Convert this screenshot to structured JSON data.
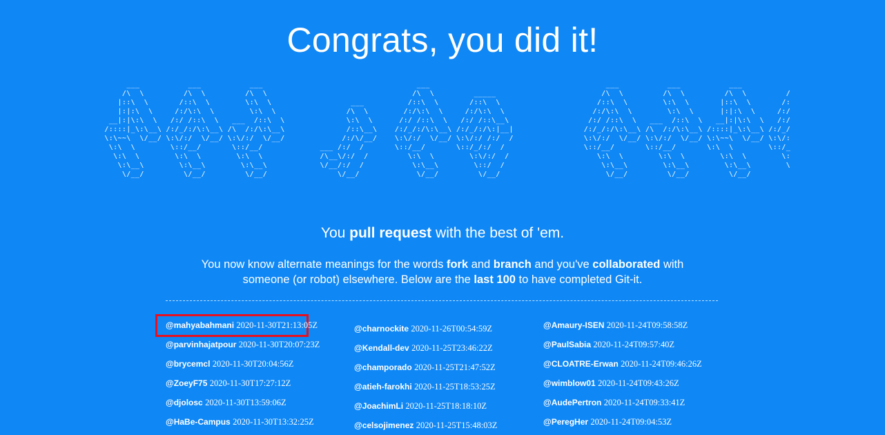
{
  "header": {
    "title": "Congrats, you did it!"
  },
  "banner": {
    "ascii_art": "      ___           ___           ___                                   ___                                        ___           ___           ___           ___           ___\n     /\\  \\         /\\  \\         /\\  \\                                 /\\  \\         _____                        /\\  \\         /\\  \\         /\\  \\         /\\  \\         /\\  \\\n    |::\\  \\       /::\\  \\        \\:\\  \\                  ___          /::\\  \\       /::\\  \\                      /::\\  \\        \\:\\  \\       |::\\  \\       /::\\  \\        \\:\\  \\         ___\n    |:|:\\  \\     /:/\\:\\  \\        \\:\\  \\                /\\  \\        /:/\\:\\  \\     /:/\\:\\  \\                    /:/\\:\\  \\        \\:\\  \\      |:|:\\  \\     /:/\\:\\  \\        \\:\\  \\       /\\__\\\n  __|:|\\:\\  \\   /:/ /::\\  \\   ___  /::\\  \\              \\:\\  \\      /:/ /::\\  \\   /:/ /::\\__\\                  /:/ /::\\  \\   ___  /::\\  \\   __|:|\\:\\  \\   /:/ /::\\  \\   _____\\:\\  \\     /:/__/\n /::::|_\\:\\__\\ /:/_/:/\\:\\__\\ /\\  /:/\\:\\__\\              /::\\__\\    /:/_/:/\\:\\__\\ /:/_/:/\\:|__|                /:/_/:/\\:\\__\\ /\\  /:/\\:\\__\\ /::::|_\\:\\__\\ /:/_/:/\\:\\__\\ /::::::::\\__\\   /::\\  \\\n \\:\\~~\\  \\/__/ \\:\\/:/  \\/__/ \\:\\/:/  \\/__/             /:/\\/__/    \\:\\/:/  \\/__/ \\:\\/:/ /:/  /                \\:\\/:/  \\/__/ \\:\\/:/  \\/__/ \\:\\~~\\  \\/__/ \\:\\/:/  \\/__/ \\:\\~~\\~~\\/__/  /:/\\:\\  \\\n  \\:\\  \\        \\::/__/       \\::/__/             ___ /:/  /       \\::/__/       \\::/_/:/  /                  \\::/__/       \\::/__/       \\:\\  \\        \\::/__/       \\:\\  \\          \\/__\\:\\  \\\n   \\:\\  \\        \\:\\  \\        \\:\\  \\             /\\__\\/:/  /         \\:\\  \\        \\:\\/:/  /                    \\:\\  \\        \\:\\  \\        \\:\\  \\        \\:\\  \\        \\:\\  \\              \\:\\  \\\n    \\:\\__\\        \\:\\__\\        \\:\\__\\            \\/__/:/  /           \\:\\__\\        \\::/  /                      \\:\\__\\        \\:\\__\\        \\:\\__\\        \\:\\__\\        \\:\\__\\              \\:\\__\\\n     \\/__/         \\/__/         \\/__/                \\/__/             \\/__/         \\/__/                        \\/__/         \\/__/         \\/__/         \\/__/         \\/__/               \\/__/"
  },
  "intro": {
    "subtitle_pre": "You ",
    "subtitle_bold": "pull request",
    "subtitle_post": " with the best of 'em.",
    "desc_1": "You now know alternate meanings for the words ",
    "desc_fork": "fork",
    "desc_2": " and ",
    "desc_branch": "branch",
    "desc_3": " and you've ",
    "desc_collab": "collaborated",
    "desc_4": " with someone (or robot) elsewhere. Below are the ",
    "desc_last": "last 100",
    "desc_5": " to have completed Git-it."
  },
  "contributors": {
    "col1": [
      {
        "user": "@mahyabahmani",
        "date": "2020-11-30T21:13:05Z"
      },
      {
        "user": "@parvinhajatpour",
        "date": "2020-11-30T20:07:23Z"
      },
      {
        "user": "@brycemcl",
        "date": "2020-11-30T20:04:56Z"
      },
      {
        "user": "@ZoeyF75",
        "date": "2020-11-30T17:27:12Z"
      },
      {
        "user": "@djolosc",
        "date": "2020-11-30T13:59:06Z"
      },
      {
        "user": "@HaBe-Campus",
        "date": "2020-11-30T13:32:25Z"
      }
    ],
    "col2": [
      {
        "user": "@charnockite",
        "date": "2020-11-26T00:54:59Z"
      },
      {
        "user": "@Kendall-dev",
        "date": "2020-11-25T23:46:22Z"
      },
      {
        "user": "@champorado",
        "date": "2020-11-25T21:47:52Z"
      },
      {
        "user": "@atieh-farokhi",
        "date": "2020-11-25T18:53:25Z"
      },
      {
        "user": "@JoachimLi",
        "date": "2020-11-25T18:18:10Z"
      },
      {
        "user": "@celsojimenez",
        "date": "2020-11-25T15:48:03Z"
      }
    ],
    "col3": [
      {
        "user": "@Amaury-ISEN",
        "date": "2020-11-24T09:58:58Z"
      },
      {
        "user": "@PaulSabia",
        "date": "2020-11-24T09:57:40Z"
      },
      {
        "user": "@CLOATRE-Erwan",
        "date": "2020-11-24T09:46:26Z"
      },
      {
        "user": "@wimblow01",
        "date": "2020-11-24T09:43:26Z"
      },
      {
        "user": "@AudePertron",
        "date": "2020-11-24T09:33:41Z"
      },
      {
        "user": "@PeregHer",
        "date": "2020-11-24T09:04:53Z"
      }
    ]
  },
  "colors": {
    "background": "#0f87f5",
    "text": "#ffffff",
    "highlight": "#e8101e"
  }
}
